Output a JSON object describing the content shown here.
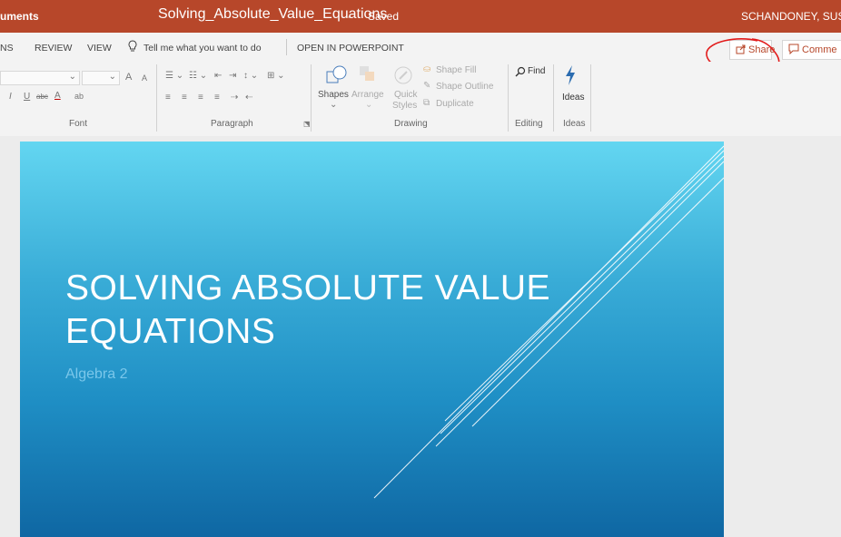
{
  "window": {
    "breadcrumb_tail": "uments",
    "doc_title": "Solving_Absolute_Value_Equations",
    "separator": "-",
    "save_status": "Saved",
    "user": "SCHANDONEY, SUSAN"
  },
  "tabs": {
    "ns": "NS",
    "review": "REVIEW",
    "view": "VIEW",
    "tell_me": "Tell me what you want to do",
    "open_in_app": "OPEN IN POWERPOINT"
  },
  "actions": {
    "share": "Share",
    "comments": "Comme"
  },
  "ribbon": {
    "font": {
      "label": "Font",
      "grow": "A",
      "shrink": "A",
      "italic": "I",
      "underline": "U",
      "strike": "abc",
      "font_color": "A",
      "highlight": "ab"
    },
    "paragraph": {
      "label": "Paragraph"
    },
    "drawing": {
      "label": "Drawing",
      "shapes": "Shapes",
      "arrange": "Arrange",
      "quick_styles_1": "Quick",
      "quick_styles_2": "Styles",
      "shape_fill": "Shape Fill",
      "shape_outline": "Shape Outline",
      "duplicate": "Duplicate"
    },
    "editing": {
      "label": "Editing",
      "find": "Find"
    },
    "ideas": {
      "label": "Ideas",
      "button": "Ideas"
    }
  },
  "slide": {
    "title_line1": "SOLVING ABSOLUTE VALUE",
    "title_line2": "EQUATIONS",
    "subtitle": "Algebra 2"
  },
  "colors": {
    "titlebar": "#b7472a",
    "accent": "#b7472a",
    "slide_top": "#63d6f1",
    "slide_bottom": "#0f67a3",
    "annotation_red": "#e21b1b"
  }
}
